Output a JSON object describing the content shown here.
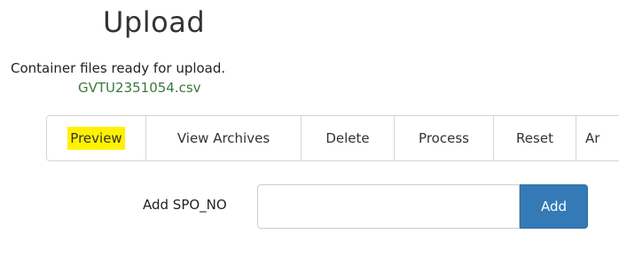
{
  "page": {
    "title": "Upload",
    "status_text": "Container files ready for upload.",
    "files": [
      "GVTU2351054.csv"
    ]
  },
  "toolbar": {
    "buttons": [
      {
        "label": "Preview",
        "highlighted": true
      },
      {
        "label": "View Archives"
      },
      {
        "label": "Delete"
      },
      {
        "label": "Process"
      },
      {
        "label": "Reset"
      },
      {
        "label": "Ar"
      }
    ]
  },
  "spo_form": {
    "label": "Add SPO_NO",
    "input_value": "",
    "add_label": "Add"
  },
  "colors": {
    "accent": "#337ab7",
    "highlight": "#fff200",
    "file_link": "#3a7a3a"
  }
}
